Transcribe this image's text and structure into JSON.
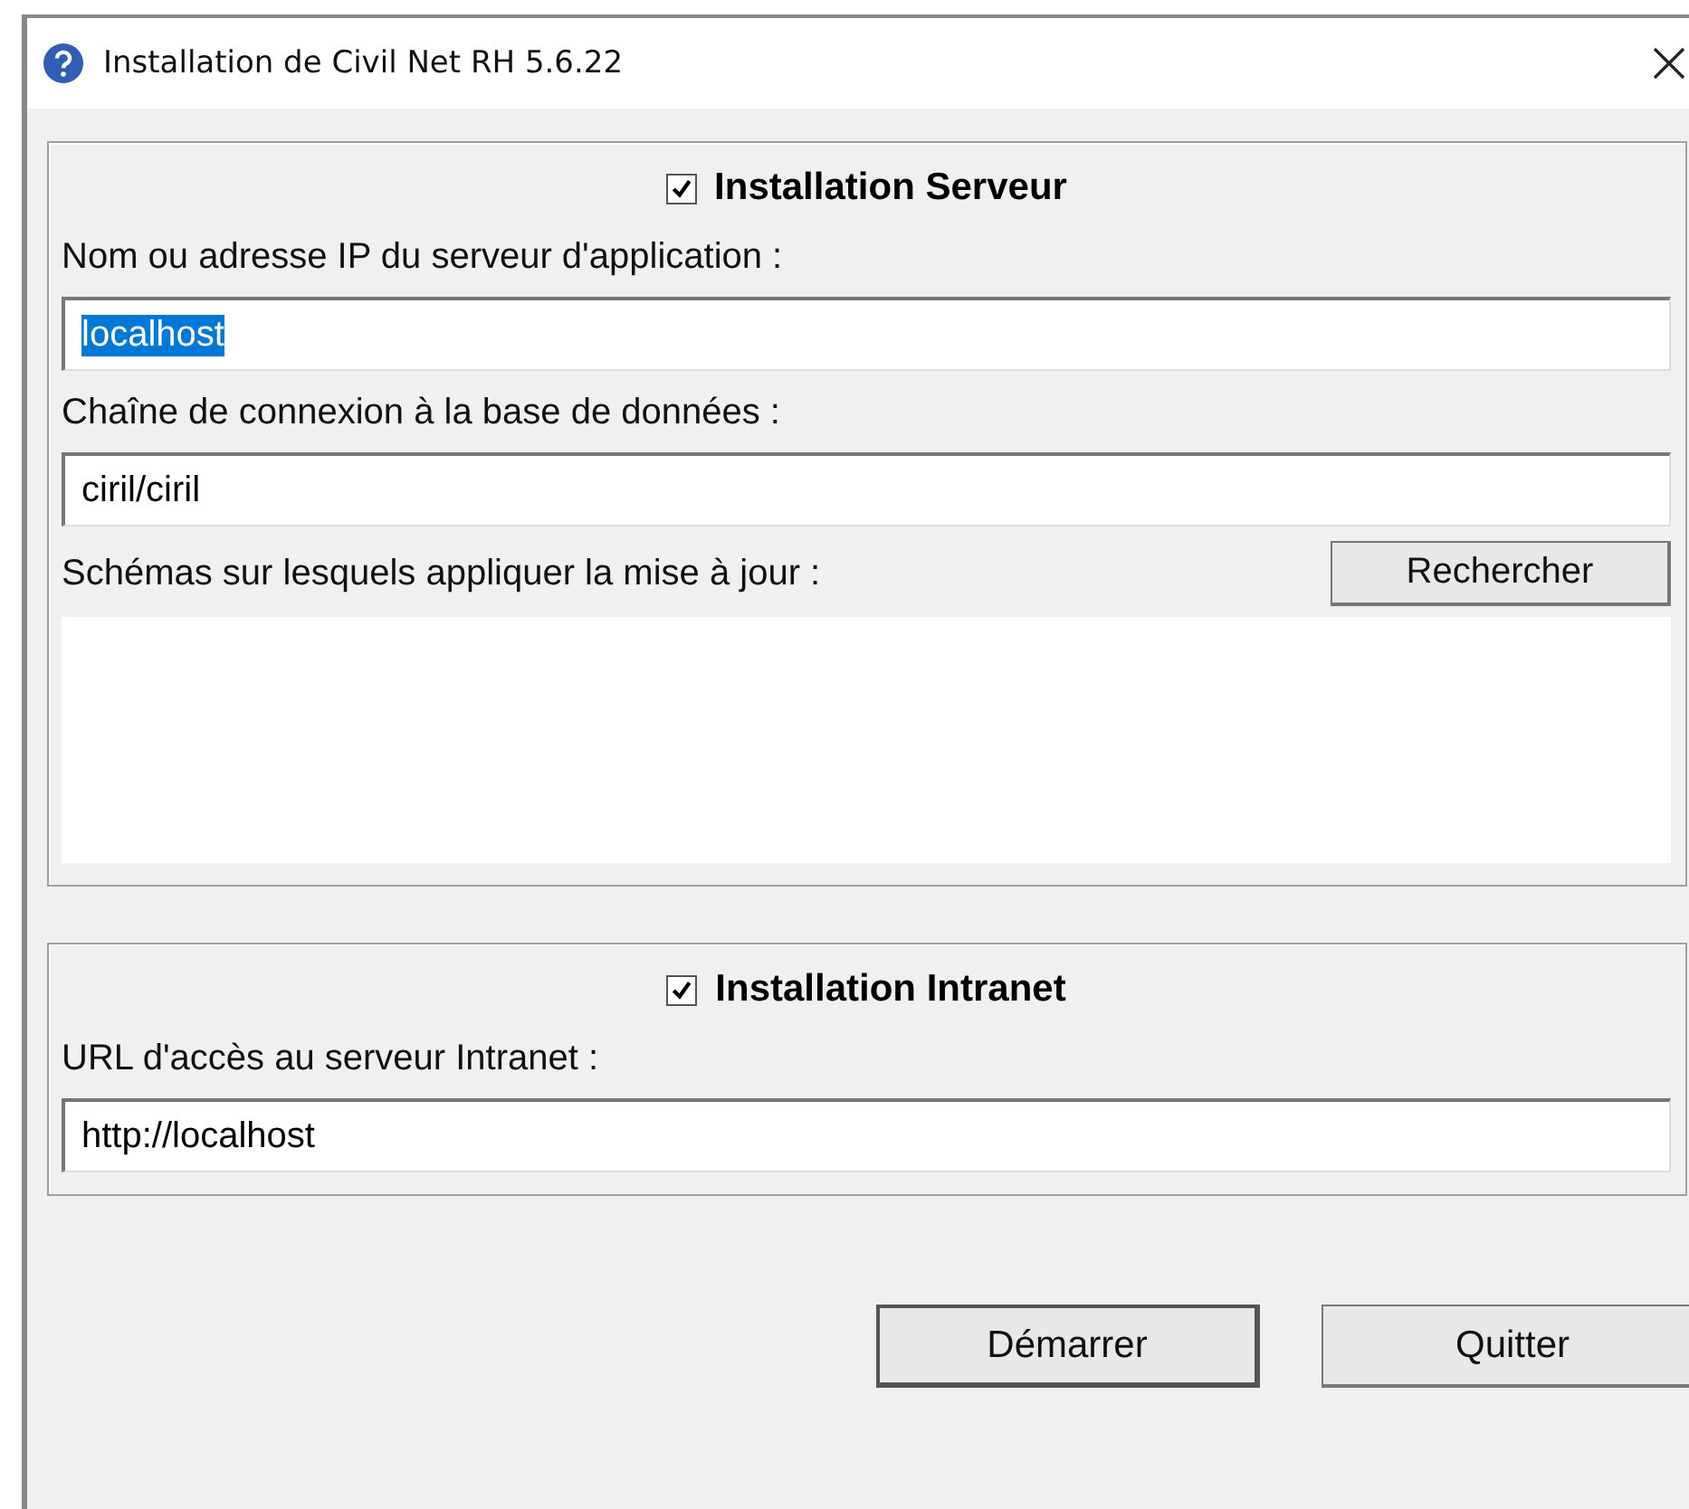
{
  "window": {
    "title": "Installation de Civil Net RH 5.6.22"
  },
  "sections": [
    {
      "title": "Installation Serveur",
      "checked": true,
      "fields": [
        {
          "kind": "text",
          "label": "Nom ou adresse IP du serveur d'application :",
          "value": "localhost",
          "selected": true
        },
        {
          "kind": "text",
          "label": "Chaîne de connexion à la base de données :",
          "value": "ciril/ciril",
          "selected": false
        },
        {
          "kind": "list",
          "label": "Schémas sur lesquels appliquer la mise à jour :",
          "button": "Rechercher"
        }
      ]
    },
    {
      "title": "Installation Intranet",
      "checked": true,
      "fields": [
        {
          "kind": "text",
          "label": "URL d'accès au serveur Intranet :",
          "value": "http://localhost",
          "selected": false
        }
      ]
    }
  ],
  "buttons": [
    {
      "label": "Démarrer",
      "default": true
    },
    {
      "label": "Quitter",
      "default": false
    }
  ]
}
